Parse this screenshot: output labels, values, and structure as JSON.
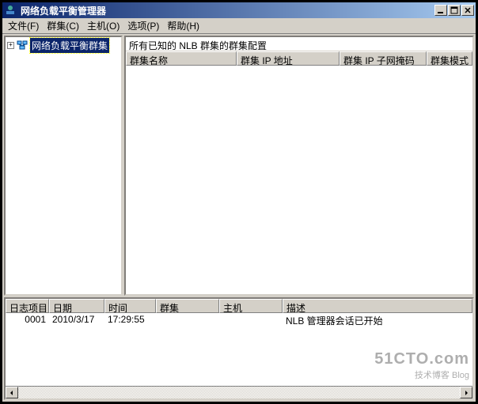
{
  "window": {
    "title": "网络负载平衡管理器"
  },
  "menu": {
    "file": "文件(F)",
    "cluster": "群集(C)",
    "host": "主机(O)",
    "options": "选项(P)",
    "help": "帮助(H)"
  },
  "tree": {
    "root": {
      "label": "网络负载平衡群集",
      "expand": "+"
    }
  },
  "right": {
    "caption": "所有已知的 NLB 群集的群集配置",
    "columns": {
      "name": "群集名称",
      "ip": "群集 IP 地址",
      "mask": "群集 IP 子网掩码",
      "mode": "群集模式"
    }
  },
  "log": {
    "columns": {
      "entry": "日志项目",
      "date": "日期",
      "time": "时间",
      "cluster": "群集",
      "host": "主机",
      "desc": "描述"
    },
    "row": {
      "entry": "0001",
      "date": "2010/3/17",
      "time": "17:29:55",
      "cluster": "",
      "host": "",
      "desc": "NLB 管理器会话已开始"
    }
  },
  "watermark": {
    "line1": "51CTO.com",
    "line2": "技术博客    Blog"
  }
}
